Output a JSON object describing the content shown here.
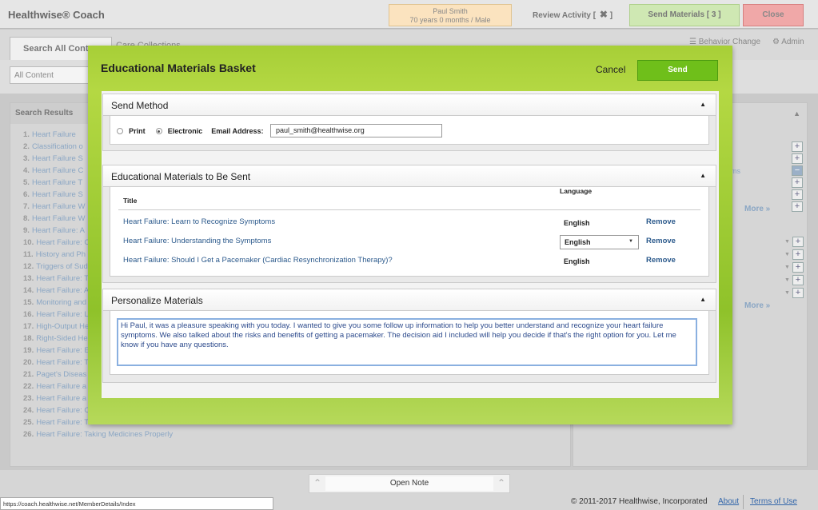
{
  "app_title": "Healthwise® Coach",
  "patient": {
    "name": "Paul Smith",
    "details": "70 years 0 months / Male"
  },
  "review": {
    "label": "Review Activity [",
    "x": "✖",
    "end": "]"
  },
  "send_materials": "Send Materials [ 3 ]",
  "close": "Close",
  "tabs": {
    "search": "Search All Cont",
    "saved": "Care Collections"
  },
  "behavior_change": "Behavior Change",
  "admin": "Admin",
  "filter": "All Content",
  "results": {
    "header": "Search Results",
    "items": [
      {
        "n": "1.",
        "t": "Heart Failure"
      },
      {
        "n": "2.",
        "t": "Classification o"
      },
      {
        "n": "3.",
        "t": "Heart Failure S"
      },
      {
        "n": "4.",
        "t": "Heart Failure C"
      },
      {
        "n": "5.",
        "t": "Heart Failure T"
      },
      {
        "n": "6.",
        "t": "Heart Failure S"
      },
      {
        "n": "7.",
        "t": "Heart Failure W"
      },
      {
        "n": "8.",
        "t": "Heart Failure W"
      },
      {
        "n": "9.",
        "t": "Heart Failure: A"
      },
      {
        "n": "10.",
        "t": "Heart Failure: C"
      },
      {
        "n": "11.",
        "t": "History and Ph"
      },
      {
        "n": "12.",
        "t": "Triggers of Sud"
      },
      {
        "n": "13.",
        "t": "Heart Failure: T"
      },
      {
        "n": "14.",
        "t": "Heart Failure: A"
      },
      {
        "n": "15.",
        "t": "Monitoring and"
      },
      {
        "n": "16.",
        "t": "Heart Failure: L"
      },
      {
        "n": "17.",
        "t": "High-Output He"
      },
      {
        "n": "18.",
        "t": "Right-Sided He"
      },
      {
        "n": "19.",
        "t": "Heart Failure: E"
      },
      {
        "n": "20.",
        "t": "Heart Failure: T"
      },
      {
        "n": "21.",
        "t": "Paget's Diseas"
      },
      {
        "n": "22.",
        "t": "Heart Failure a"
      },
      {
        "n": "23.",
        "t": "Heart Failure a"
      },
      {
        "n": "24.",
        "t": "Heart Failure: C"
      },
      {
        "n": "25.",
        "t": "Heart Failure: T"
      },
      {
        "n": "26.",
        "t": "Heart Failure: Taking Medicines Properly"
      }
    ]
  },
  "right_panel": {
    "ms": "ms",
    "more1": "More »",
    "more2": "More »"
  },
  "modal": {
    "title": "Educational Materials Basket",
    "cancel": "Cancel",
    "send": "Send",
    "send_method": {
      "header": "Send Method",
      "print": "Print",
      "electronic": "Electronic",
      "email_label": "Email Address:",
      "email_value": "paul_smith@healthwise.org"
    },
    "materials": {
      "header": "Educational Materials to Be Sent",
      "col_title": "Title",
      "col_language": "Language",
      "rows": [
        {
          "title": "Heart Failure: Learn to Recognize Symptoms",
          "language": "English",
          "remove": "Remove"
        },
        {
          "title": "Heart Failure: Understanding the Symptoms",
          "language": "English",
          "remove": "Remove"
        },
        {
          "title": "Heart Failure: Should I Get a Pacemaker (Cardiac Resynchronization Therapy)?",
          "language": "English",
          "remove": "Remove"
        }
      ]
    },
    "personalize": {
      "header": "Personalize Materials",
      "message": "Hi Paul, it was a pleasure speaking with you today. I wanted to give you some follow up information to help you better understand and recognize your heart failure symptoms. We also talked about the risks and benefits of getting a pacemaker. The decision aid I included will help you decide if that's the right option for you. Let me know if you have any questions."
    }
  },
  "footer": {
    "open_note": "Open Note",
    "url": "https://coach.healthwise.net/MemberDetails/Index",
    "copyright": "© 2011-2017 Healthwise, Incorporated",
    "about": "About",
    "terms": "Terms of Use"
  }
}
